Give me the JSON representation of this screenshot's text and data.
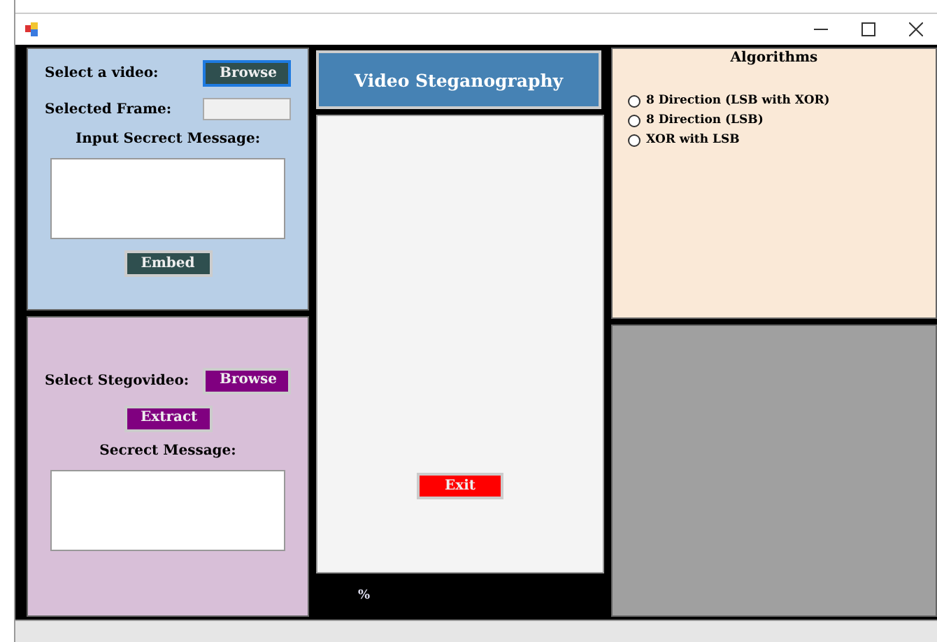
{
  "embed_panel": {
    "select_label": "Select a video:",
    "browse_button": "Browse",
    "frame_label": "Selected Frame:",
    "message_label": "Input Secrect Message:",
    "embed_button": "Embed"
  },
  "extract_panel": {
    "select_label": "Select Stegovideo:",
    "browse_button": "Browse",
    "extract_button": "Extract",
    "message_label": "Secrect Message:"
  },
  "title_button": "Video Steganography",
  "exit_button": "Exit",
  "progress_text": "%",
  "algorithms": {
    "title": "Algorithms",
    "options": [
      {
        "label": "8 Direction (LSB with XOR)",
        "selected": false
      },
      {
        "label": "8 Direction (LSB)",
        "selected": false
      },
      {
        "label": "XOR with LSB",
        "selected": false
      }
    ]
  }
}
